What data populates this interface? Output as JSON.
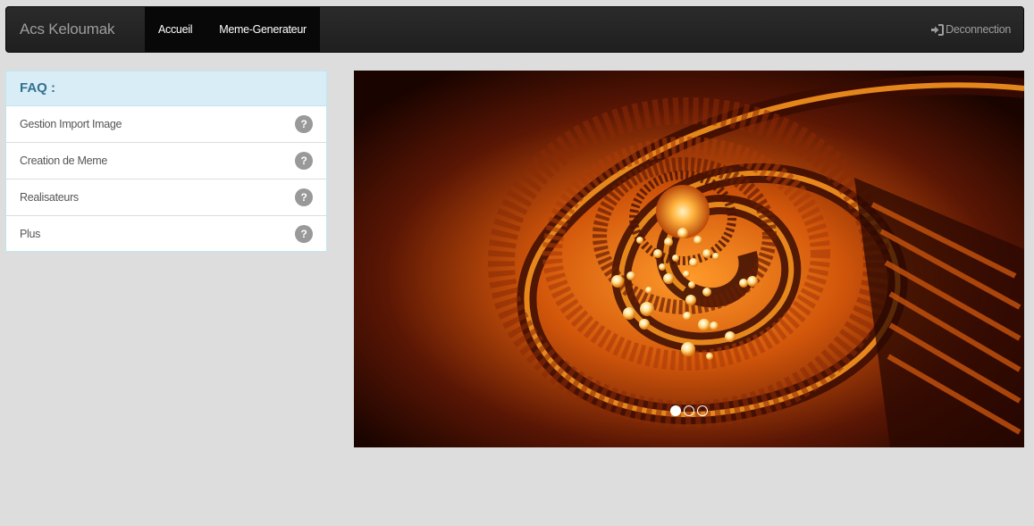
{
  "navbar": {
    "brand": "Acs Keloumak",
    "links": [
      {
        "label": "Accueil"
      },
      {
        "label": "Meme-Generateur"
      }
    ],
    "logout_label": "Deconnection",
    "logout_icon": "sign-in-icon"
  },
  "faq": {
    "title": "FAQ :",
    "items": [
      {
        "label": "Gestion Import Image",
        "icon": "question-icon",
        "icon_glyph": "?"
      },
      {
        "label": "Creation de Meme",
        "icon": "question-icon",
        "icon_glyph": "?"
      },
      {
        "label": "Realisateurs",
        "icon": "question-icon",
        "icon_glyph": "?"
      },
      {
        "label": "Plus",
        "icon": "question-icon",
        "icon_glyph": "?"
      }
    ]
  },
  "carousel": {
    "slide_count": 3,
    "active_index": 0
  },
  "colors": {
    "navbar_bg": "#222222",
    "page_bg": "#dddddd",
    "panel_heading_bg": "#d9edf7",
    "panel_heading_text": "#31708f",
    "accent_orange": "#f28a1a"
  }
}
